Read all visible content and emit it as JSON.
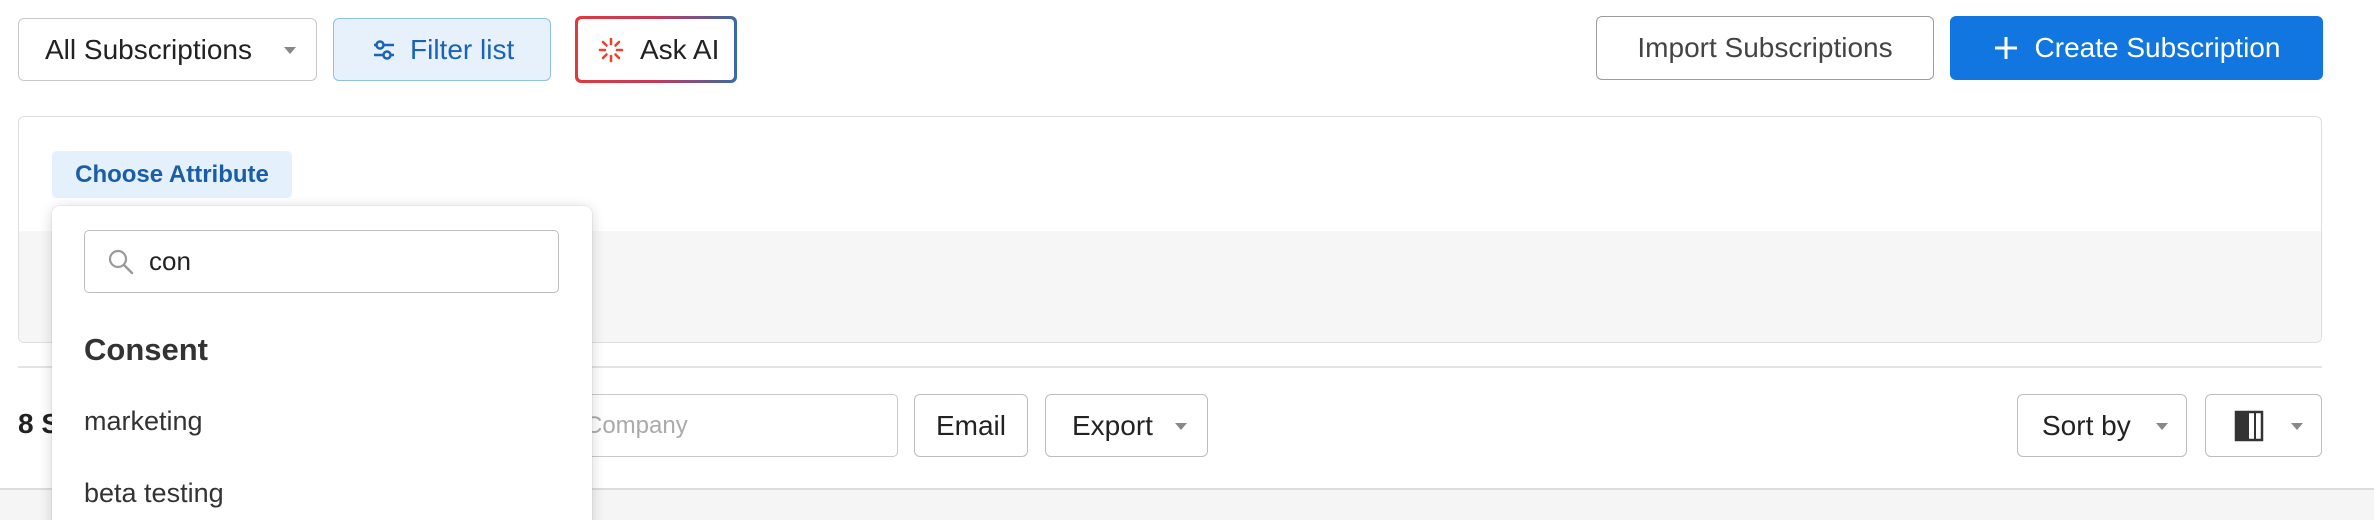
{
  "toolbar": {
    "view_select": "All Subscriptions",
    "filter_label": "Filter list",
    "ask_ai_label": "Ask AI",
    "import_label": "Import Subscriptions",
    "create_label": "Create Subscription"
  },
  "filter_panel": {
    "choose_attribute_label": "Choose Attribute"
  },
  "attribute_dropdown": {
    "search_value": "con",
    "group_title": "Consent",
    "items": [
      "marketing",
      "beta testing"
    ]
  },
  "results_bar": {
    "count_text": "8 S",
    "company_placeholder": "Company",
    "email_label": "Email",
    "export_label": "Export",
    "sort_label": "Sort by"
  },
  "colors": {
    "primary": "#1276e0",
    "filter_bg": "#e6f1fb",
    "filter_text": "#1a63b8",
    "ai_gradient_start": "#e03a3e",
    "ai_gradient_end": "#3b6aa8"
  },
  "icons": {
    "filter": "sliders-icon",
    "ask_ai": "sparkle-spinner-icon",
    "create": "plus-icon",
    "search": "search-icon",
    "columns": "column-toggle-icon"
  }
}
